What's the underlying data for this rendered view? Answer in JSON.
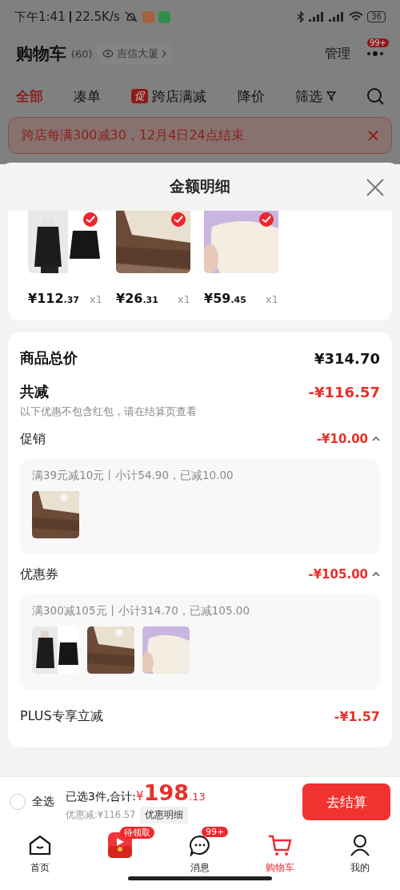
{
  "status_bar": {
    "time": "下午1:41",
    "speed": "22.5K/s",
    "battery": "36"
  },
  "header": {
    "title": "购物车",
    "count": "(60)",
    "location": "吉信大厦",
    "manage": "管理",
    "badge": "99+"
  },
  "tabs": [
    {
      "label": "全部",
      "selected": true
    },
    {
      "label": "凑单",
      "selected": false
    },
    {
      "label": "跨店满减",
      "selected": false,
      "badge": "促"
    },
    {
      "label": "降价",
      "selected": false
    },
    {
      "label": "筛选",
      "selected": false,
      "kind": "filter"
    }
  ],
  "banner": {
    "text": "跨店每满300减30，12月4日24点结束"
  },
  "sheet": {
    "title": "金额明细",
    "products": [
      {
        "price": "¥112",
        "cents": ".37",
        "qty": "x1",
        "checked": true
      },
      {
        "price": "¥26",
        "cents": ".31",
        "qty": "x1",
        "checked": true
      },
      {
        "price": "¥59",
        "cents": ".45",
        "qty": "x1",
        "checked": true
      }
    ],
    "total": {
      "label": "商品总价",
      "value": "¥314.70"
    },
    "reduction": {
      "label": "共减",
      "value": "-¥116.57",
      "note": "以下优惠不包含红包，请在结算页查看"
    },
    "sections": [
      {
        "label": "促销",
        "amount": "-¥10.00",
        "expanded": true,
        "rule": "满39元减10元丨小计54.90，已减10.00"
      },
      {
        "label": "优惠券",
        "amount": "-¥105.00",
        "expanded": true,
        "rule": "满300减105元丨小计314.70，已减105.00"
      }
    ],
    "plus": {
      "label": "PLUS专享立减",
      "amount": "-¥1.57"
    }
  },
  "footer": {
    "select_all": {
      "label": "全选",
      "checked": false
    },
    "summary": "已选3件,合计:",
    "currency": "¥",
    "total": "198",
    "cents": ".13",
    "discount": "优惠减:¥116.57",
    "detail": "优惠明细",
    "checkout": "去结算"
  },
  "nav": [
    {
      "kind": "home",
      "label": "首页",
      "selected": false
    },
    {
      "kind": "gift",
      "badge": "待领取",
      "selected": false
    },
    {
      "kind": "message",
      "label": "消息",
      "badge": "99+",
      "selected": false
    },
    {
      "kind": "cart",
      "label": "购物车",
      "selected": true
    },
    {
      "kind": "profile",
      "label": "我的",
      "selected": false
    }
  ]
}
